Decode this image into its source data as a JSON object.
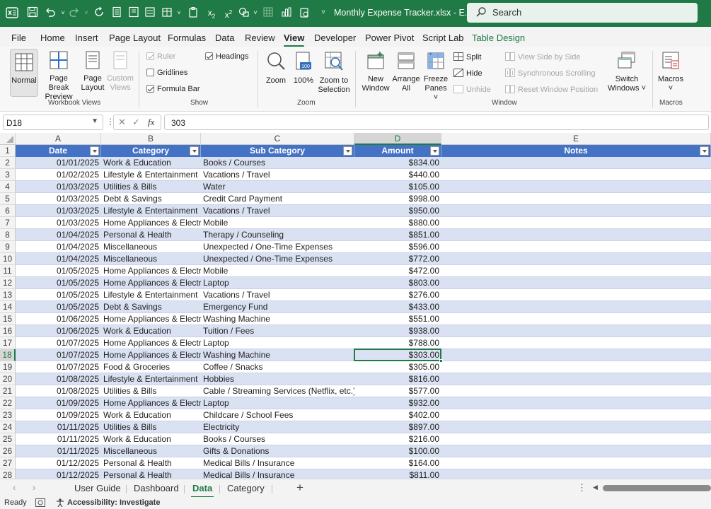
{
  "titlebar": {
    "title": "Monthly Expense Tracker.xlsx  -  E...",
    "search_placeholder": "Search"
  },
  "tabs": [
    "File",
    "Home",
    "Insert",
    "Page Layout",
    "Formulas",
    "Data",
    "Review",
    "View",
    "Developer",
    "Power Pivot",
    "Script Lab",
    "Table Design"
  ],
  "active_tab": "View",
  "ribbon": {
    "workbook_views": {
      "label": "Workbook Views",
      "normal": "Normal",
      "page_break_1": "Page Break",
      "page_break_2": "Preview",
      "page_layout_1": "Page",
      "page_layout_2": "Layout",
      "custom_1": "Custom",
      "custom_2": "Views"
    },
    "show": {
      "label": "Show",
      "ruler": "Ruler",
      "gridlines": "Gridlines",
      "formula_bar": "Formula Bar",
      "headings": "Headings"
    },
    "zoom": {
      "label": "Zoom",
      "zoom": "Zoom",
      "hundred": "100%",
      "zoom_sel_1": "Zoom to",
      "zoom_sel_2": "Selection"
    },
    "window": {
      "label": "Window",
      "new_1": "New",
      "new_2": "Window",
      "arrange_1": "Arrange",
      "arrange_2": "All",
      "freeze_1": "Freeze",
      "freeze_2": "Panes ˅",
      "split": "Split",
      "hide": "Hide",
      "unhide": "Unhide",
      "side_by_side": "View Side by Side",
      "sync_scroll": "Synchronous Scrolling",
      "reset_pos": "Reset Window Position",
      "switch_1": "Switch",
      "switch_2": "Windows ˅"
    },
    "macros": {
      "label": "Macros",
      "btn": "Macros",
      "arrow": "˅"
    }
  },
  "formula_bar": {
    "name_box": "D18",
    "value": "303"
  },
  "columns": [
    "A",
    "B",
    "C",
    "D",
    "E"
  ],
  "headers": [
    "Date",
    "Category",
    "Sub Category",
    "Amount",
    "Notes"
  ],
  "rows": [
    [
      "01/01/2025",
      "Work & Education",
      "Books / Courses",
      "$834.00"
    ],
    [
      "01/02/2025",
      "Lifestyle & Entertainment",
      "Vacations / Travel",
      "$440.00"
    ],
    [
      "01/03/2025",
      "Utilities & Bills",
      "Water",
      "$105.00"
    ],
    [
      "01/03/2025",
      "Debt & Savings",
      "Credit Card Payment",
      "$998.00"
    ],
    [
      "01/03/2025",
      "Lifestyle & Entertainment",
      "Vacations / Travel",
      "$950.00"
    ],
    [
      "01/03/2025",
      "Home Appliances & Electronics",
      "Mobile",
      "$880.00"
    ],
    [
      "01/04/2025",
      "Personal & Health",
      "Therapy / Counseling",
      "$851.00"
    ],
    [
      "01/04/2025",
      "Miscellaneous",
      "Unexpected / One-Time Expenses",
      "$596.00"
    ],
    [
      "01/04/2025",
      "Miscellaneous",
      "Unexpected / One-Time Expenses",
      "$772.00"
    ],
    [
      "01/05/2025",
      "Home Appliances & Electronics",
      "Mobile",
      "$472.00"
    ],
    [
      "01/05/2025",
      "Home Appliances & Electronics",
      "Laptop",
      "$803.00"
    ],
    [
      "01/05/2025",
      "Lifestyle & Entertainment",
      "Vacations / Travel",
      "$276.00"
    ],
    [
      "01/05/2025",
      "Debt & Savings",
      "Emergency Fund",
      "$433.00"
    ],
    [
      "01/06/2025",
      "Home Appliances & Electronics",
      "Washing Machine",
      "$551.00"
    ],
    [
      "01/06/2025",
      "Work & Education",
      "Tuition / Fees",
      "$938.00"
    ],
    [
      "01/07/2025",
      "Home Appliances & Electronics",
      "Laptop",
      "$788.00"
    ],
    [
      "01/07/2025",
      "Home Appliances & Electronics",
      "Washing Machine",
      "$303.00"
    ],
    [
      "01/07/2025",
      "Food & Groceries",
      "Coffee / Snacks",
      "$305.00"
    ],
    [
      "01/08/2025",
      "Lifestyle & Entertainment",
      "Hobbies",
      "$816.00"
    ],
    [
      "01/08/2025",
      "Utilities & Bills",
      "Cable / Streaming Services (Netflix, etc.)",
      "$577.00"
    ],
    [
      "01/09/2025",
      "Home Appliances & Electronics",
      "Laptop",
      "$932.00"
    ],
    [
      "01/09/2025",
      "Work & Education",
      "Childcare / School Fees",
      "$402.00"
    ],
    [
      "01/11/2025",
      "Utilities & Bills",
      "Electricity",
      "$897.00"
    ],
    [
      "01/11/2025",
      "Work & Education",
      "Books / Courses",
      "$216.00"
    ],
    [
      "01/11/2025",
      "Miscellaneous",
      "Gifts & Donations",
      "$100.00"
    ],
    [
      "01/12/2025",
      "Personal & Health",
      "Medical Bills / Insurance",
      "$164.00"
    ],
    [
      "01/12/2025",
      "Personal & Health",
      "Medical Bills / Insurance",
      "$811.00"
    ]
  ],
  "selected": {
    "row": 18,
    "col": "D"
  },
  "sheets": [
    "User Guide",
    "Dashboard",
    "Data",
    "Category"
  ],
  "active_sheet": "Data",
  "status": {
    "ready": "Ready",
    "accessibility": "Accessibility: Investigate"
  },
  "colors": {
    "brand": "#1f7a45",
    "table_header": "#4472c4",
    "band": "#d9e1f2"
  }
}
